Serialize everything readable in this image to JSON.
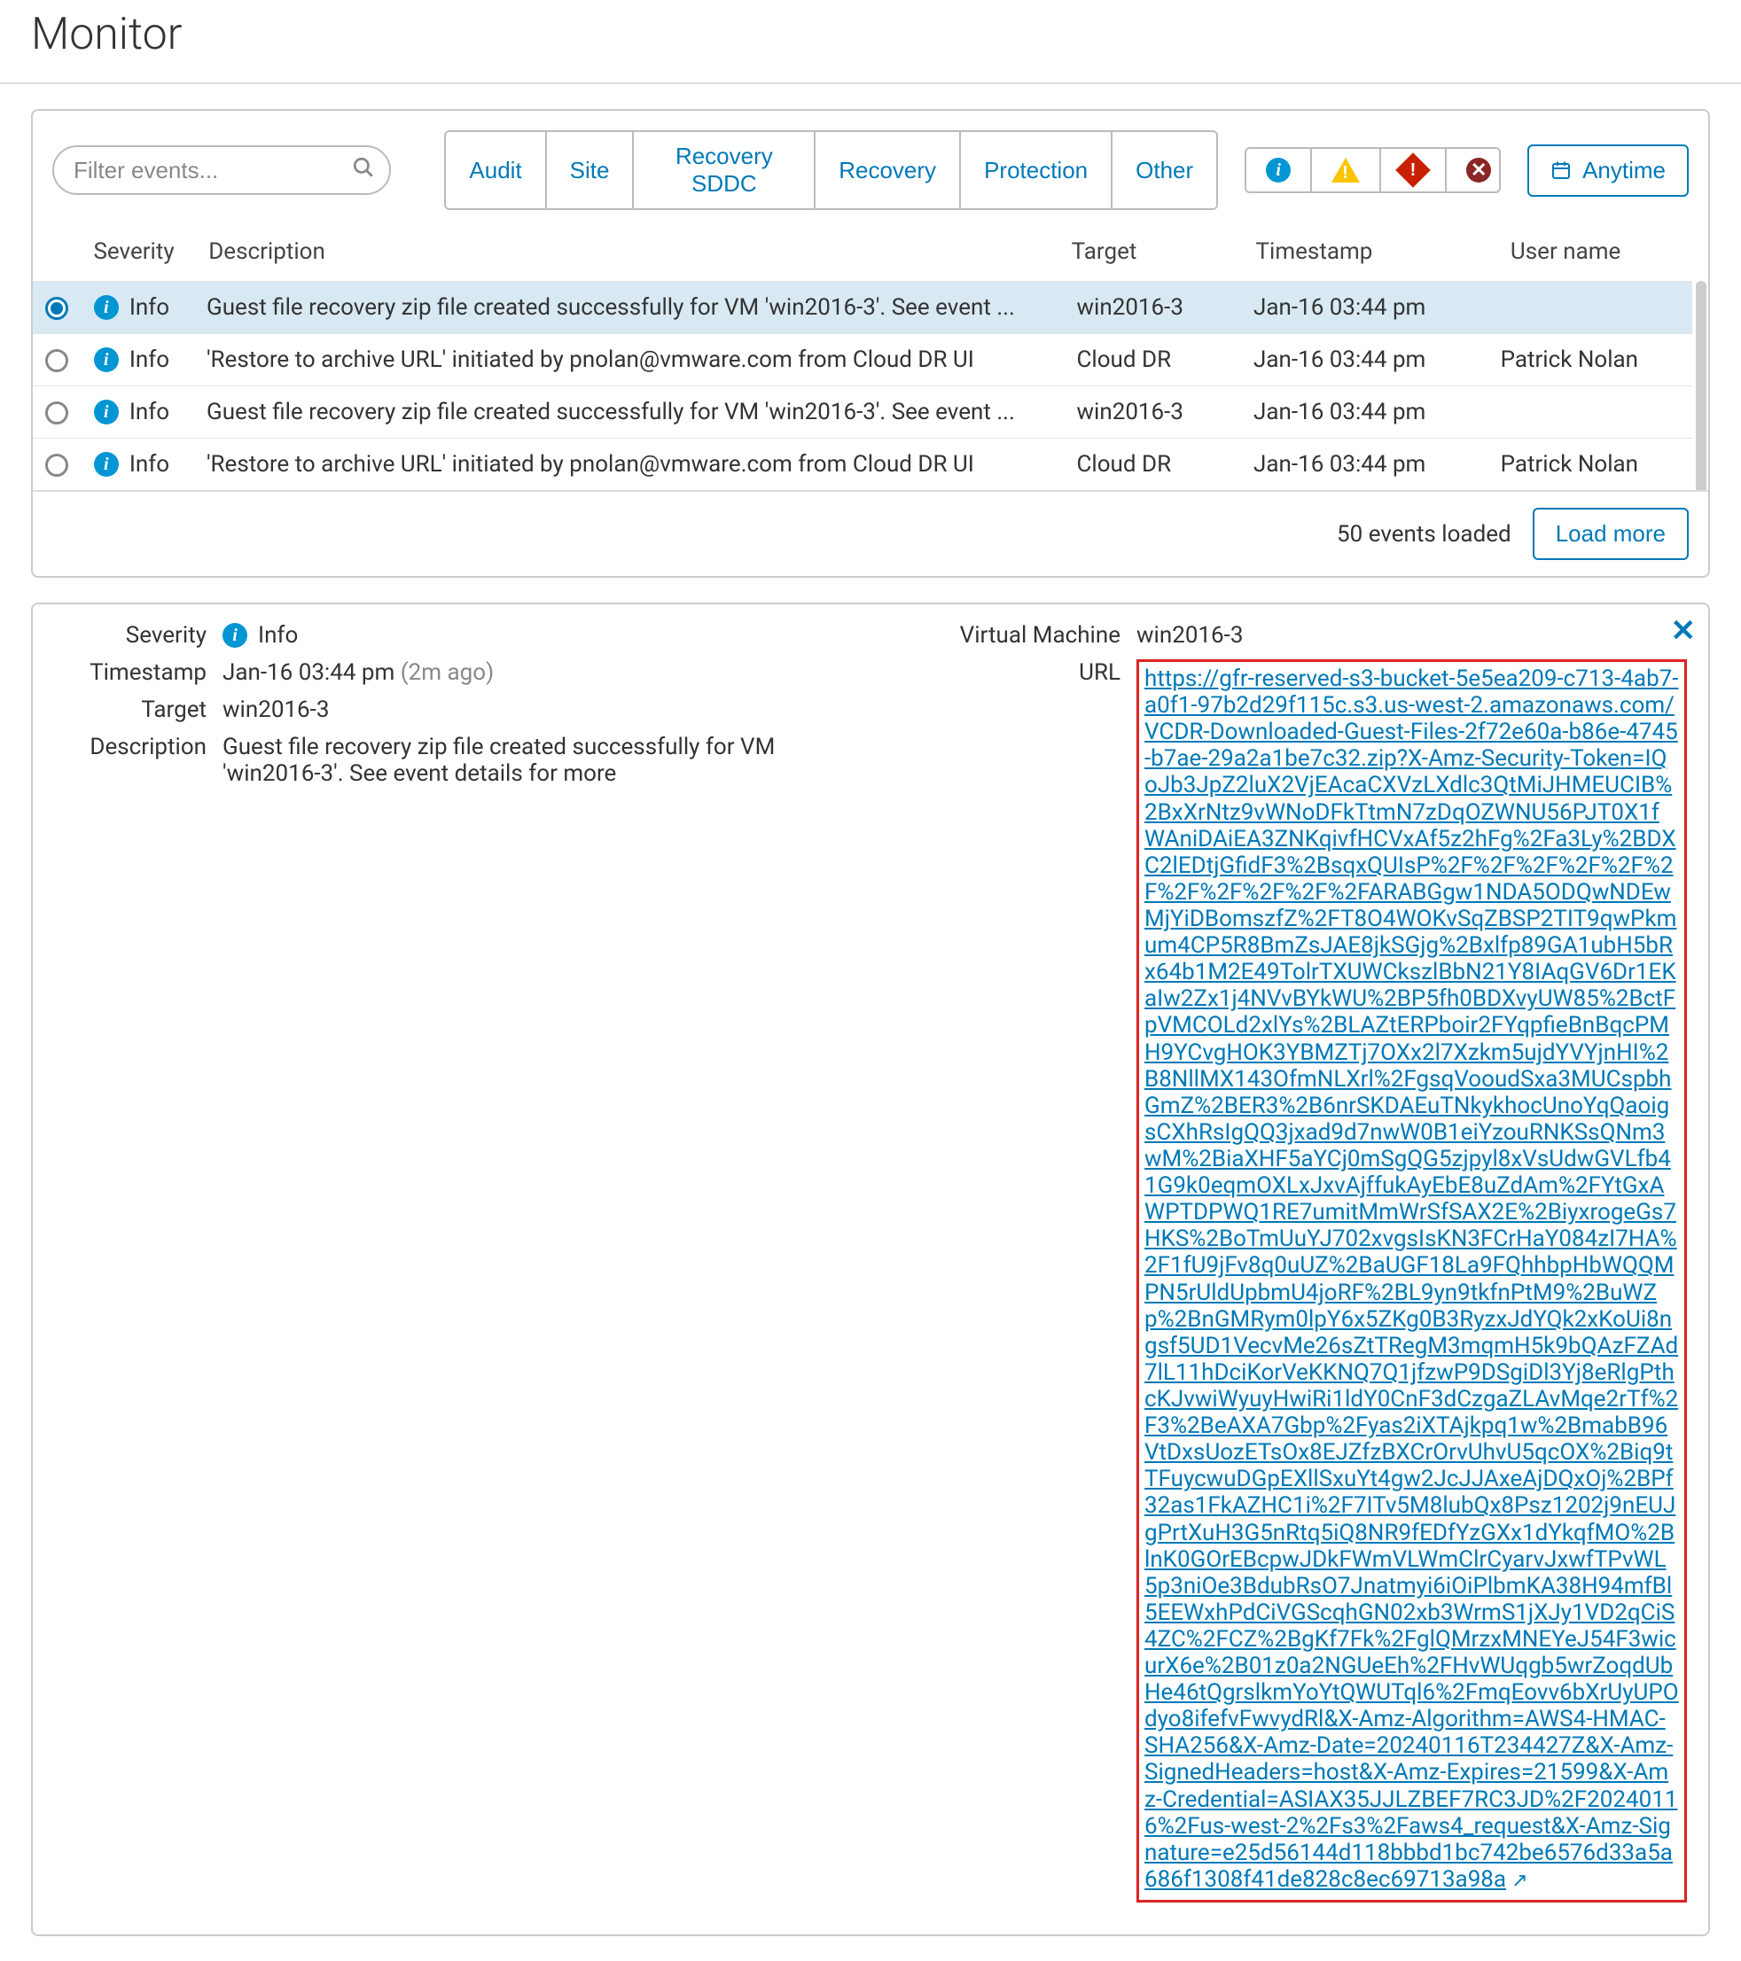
{
  "page_title": "Monitor",
  "search": {
    "placeholder": "Filter events..."
  },
  "category_filters": [
    "Audit",
    "Site",
    "Recovery SDDC",
    "Recovery",
    "Protection",
    "Other"
  ],
  "time_filter_label": "Anytime",
  "table": {
    "columns": {
      "severity": "Severity",
      "description": "Description",
      "target": "Target",
      "timestamp": "Timestamp",
      "user": "User name"
    },
    "rows": [
      {
        "selected": true,
        "severity": "Info",
        "description": "Guest file recovery zip file created successfully for VM 'win2016-3'. See event ...",
        "target": "win2016-3",
        "timestamp": "Jan-16 03:44 pm",
        "user": ""
      },
      {
        "selected": false,
        "severity": "Info",
        "description": "'Restore to archive URL' initiated by pnolan@vmware.com from Cloud DR UI",
        "target": "Cloud DR",
        "timestamp": "Jan-16 03:44 pm",
        "user": "Patrick Nolan"
      },
      {
        "selected": false,
        "severity": "Info",
        "description": "Guest file recovery zip file created successfully for VM 'win2016-3'. See event ...",
        "target": "win2016-3",
        "timestamp": "Jan-16 03:44 pm",
        "user": ""
      },
      {
        "selected": false,
        "severity": "Info",
        "description": "'Restore to archive URL' initiated by pnolan@vmware.com from Cloud DR UI",
        "target": "Cloud DR",
        "timestamp": "Jan-16 03:44 pm",
        "user": "Patrick Nolan"
      }
    ],
    "loaded_text": "50 events loaded",
    "load_more": "Load more"
  },
  "details": {
    "labels": {
      "severity": "Severity",
      "timestamp": "Timestamp",
      "target": "Target",
      "description": "Description",
      "vm": "Virtual Machine",
      "url": "URL"
    },
    "severity_text": "Info",
    "timestamp": "Jan-16 03:44 pm",
    "timestamp_relative": "(2m ago)",
    "target": "win2016-3",
    "description": "Guest file recovery zip file created successfully for VM 'win2016-3'. See event details for more",
    "virtual_machine": "win2016-3",
    "url": "https://gfr-reserved-s3-bucket-5e5ea209-c713-4ab7-a0f1-97b2d29f115c.s3.us-west-2.amazonaws.com/VCDR-Downloaded-Guest-Files-2f72e60a-b86e-4745-b7ae-29a2a1be7c32.zip?X-Amz-Security-Token=IQoJb3JpZ2luX2VjEAcaCXVzLXdlc3QtMiJHMEUCIB%2BxXrNtz9vWNoDFkTtmN7zDqOZWNU56PJT0X1fWAniDAiEA3ZNKqivfHCVxAf5z2hFg%2Fa3Ly%2BDXC2lEDtjGfidF3%2BsqxQUIsP%2F%2F%2F%2F%2F%2F%2F%2F%2F%2F%2FARABGgw1NDA5ODQwNDEwMjYiDBomszfZ%2FT8O4WOKvSqZBSP2TIT9qwPkmum4CP5R8BmZsJAE8jkSGjg%2Bxlfp89GA1ubH5bRx64b1M2E49TolrTXUWCkszlBbN21Y8IAqGV6Dr1EKaIw2Zx1j4NVvBYkWU%2BP5fh0BDXvyUW85%2BctFpVMCOLd2xlYs%2BLAZtERPboir2FYqpfieBnBqcPMH9YCvgHOK3YBMZTj7OXx2l7Xzkm5ujdYVYjnHI%2B8NllMX143OfmNLXrl%2FgsqVooudSxa3MUCspbhGmZ%2BER3%2B6nrSKDAEuTNkykhocUnoYqQaoigsCXhRsIgQQ3jxad9d7nwW0B1eiYzouRNKSsQNm3wM%2BiaXHF5aYCj0mSgQG5zjpyl8xVsUdwGVLfb41G9k0eqmOXLxJxvAjffukAyEbE8uZdAm%2FYtGxAWPTDPWQ1RE7umitMmWrSfSAX2E%2BiyxrogeGs7HKS%2BoTmUuYJ702xvgsIsKN3FCrHaY084zI7HA%2F1fU9jFv8q0uUZ%2BaUGF18La9FQhhbpHbWQQMPN5rUldUpbmU4joRF%2BL9yn9tkfnPtM9%2BuWZp%2BnGMRym0lpY6x5ZKg0B3RyzxJdYQk2xKoUi8ngsf5UD1VecvMe26sZtTRegM3mqmH5k9bQAzFZAd7lL11hDciKorVeKKNQ7Q1jfzwP9DSgiDl3Yj8eRlgPthcKJvwiWyuyHwiRi1ldY0CnF3dCzgaZLAvMqe2rTf%2F3%2BeAXA7Gbp%2Fyas2iXTAjkpq1w%2BmabB96VtDxsUozETsOx8EJZfzBXCrOrvUhvU5qcOX%2Biq9tTFuycwuDGpEXllSxuYt4gw2JcJJAxeAjDQxOj%2BPf32as1FkAZHC1i%2F7ITv5M8lubQx8Psz1202j9nEUJgPrtXuH3G5nRtq5iQ8NR9fEDfYzGXx1dYkqfMO%2BlnK0GOrEBcpwJDkFWmVLWmClrCyarvJxwfTPvWL5p3niOe3BdubRsO7Jnatmyi6iOiPlbmKA38H94mfBl5EEWxhPdCiVGScqhGN02xb3WrmS1jXJy1VD2qCiS4ZC%2FCZ%2BgKf7Fk%2FglQMrzxMNEYeJ54F3wicurX6e%2B01z0a2NGUeEh%2FHvWUqgb5wrZoqdUbHe46tQgrslkmYoYtQWUTql6%2FmqEovv6bXrUyUPOdyo8ifefvFwvydRl&X-Amz-Algorithm=AWS4-HMAC-SHA256&X-Amz-Date=20240116T234427Z&X-Amz-SignedHeaders=host&X-Amz-Expires=21599&X-Amz-Credential=ASIAX35JJLZBEF7RC3JD%2F20240116%2Fus-west-2%2Fs3%2Faws4_request&X-Amz-Signature=e25d56144d118bbbd1bc742be6576d33a5a686f1308f41de828c8ec69713a98a"
  }
}
